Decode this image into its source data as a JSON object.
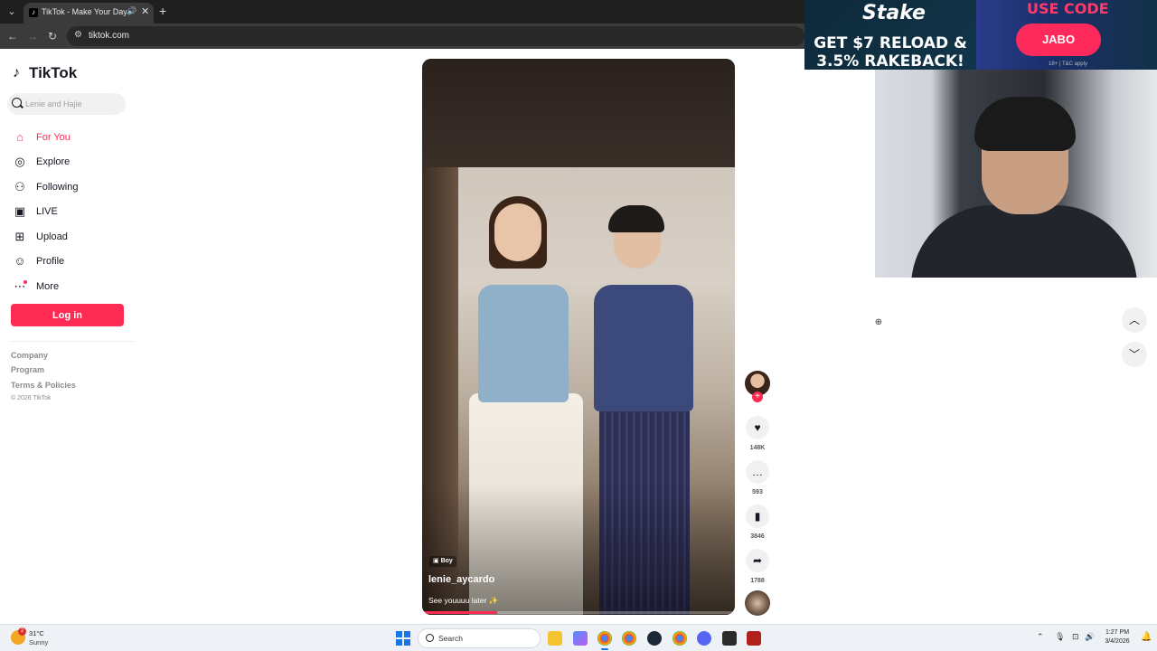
{
  "browser": {
    "tab_title": "TikTok - Make Your Day",
    "url": "tiktok.com"
  },
  "ad": {
    "brand": "Stake",
    "headline": "GET $7 RELOAD & 3.5% RAKEBACK!",
    "use_code_label": "USE CODE",
    "code": "JABO",
    "fine_print": "18+ | T&C apply"
  },
  "sidebar": {
    "logo": "TikTok",
    "search_placeholder": "Lenie and Hajie",
    "nav": [
      {
        "label": "For You",
        "icon": "home-icon",
        "active": true
      },
      {
        "label": "Explore",
        "icon": "compass-icon"
      },
      {
        "label": "Following",
        "icon": "following-icon"
      },
      {
        "label": "LIVE",
        "icon": "live-tv-icon"
      },
      {
        "label": "Upload",
        "icon": "upload-plus-icon"
      },
      {
        "label": "Profile",
        "icon": "profile-icon"
      },
      {
        "label": "More",
        "icon": "more-dots-icon"
      }
    ],
    "login_label": "Log in",
    "footer_links": [
      "Company",
      "Program",
      "Terms & Policies"
    ],
    "copyright": "© 2026 TikTok"
  },
  "video": {
    "tag": "Boy",
    "username": "lenie_aycardo",
    "caption": "See youuuu later ✨",
    "progress": 0.24,
    "likes": "148K",
    "comments": "593",
    "saves": "3846",
    "shares": "1788"
  },
  "taskbar": {
    "weather_temp": "31°C",
    "weather_desc": "Sunny",
    "weather_badge": "2",
    "search_label": "Search",
    "time": "1:27 PM",
    "date": "3/4/2026"
  },
  "colors": {
    "accent": "#fe2c55",
    "text": "#161823",
    "chrome_dark": "#1f1f1f"
  }
}
